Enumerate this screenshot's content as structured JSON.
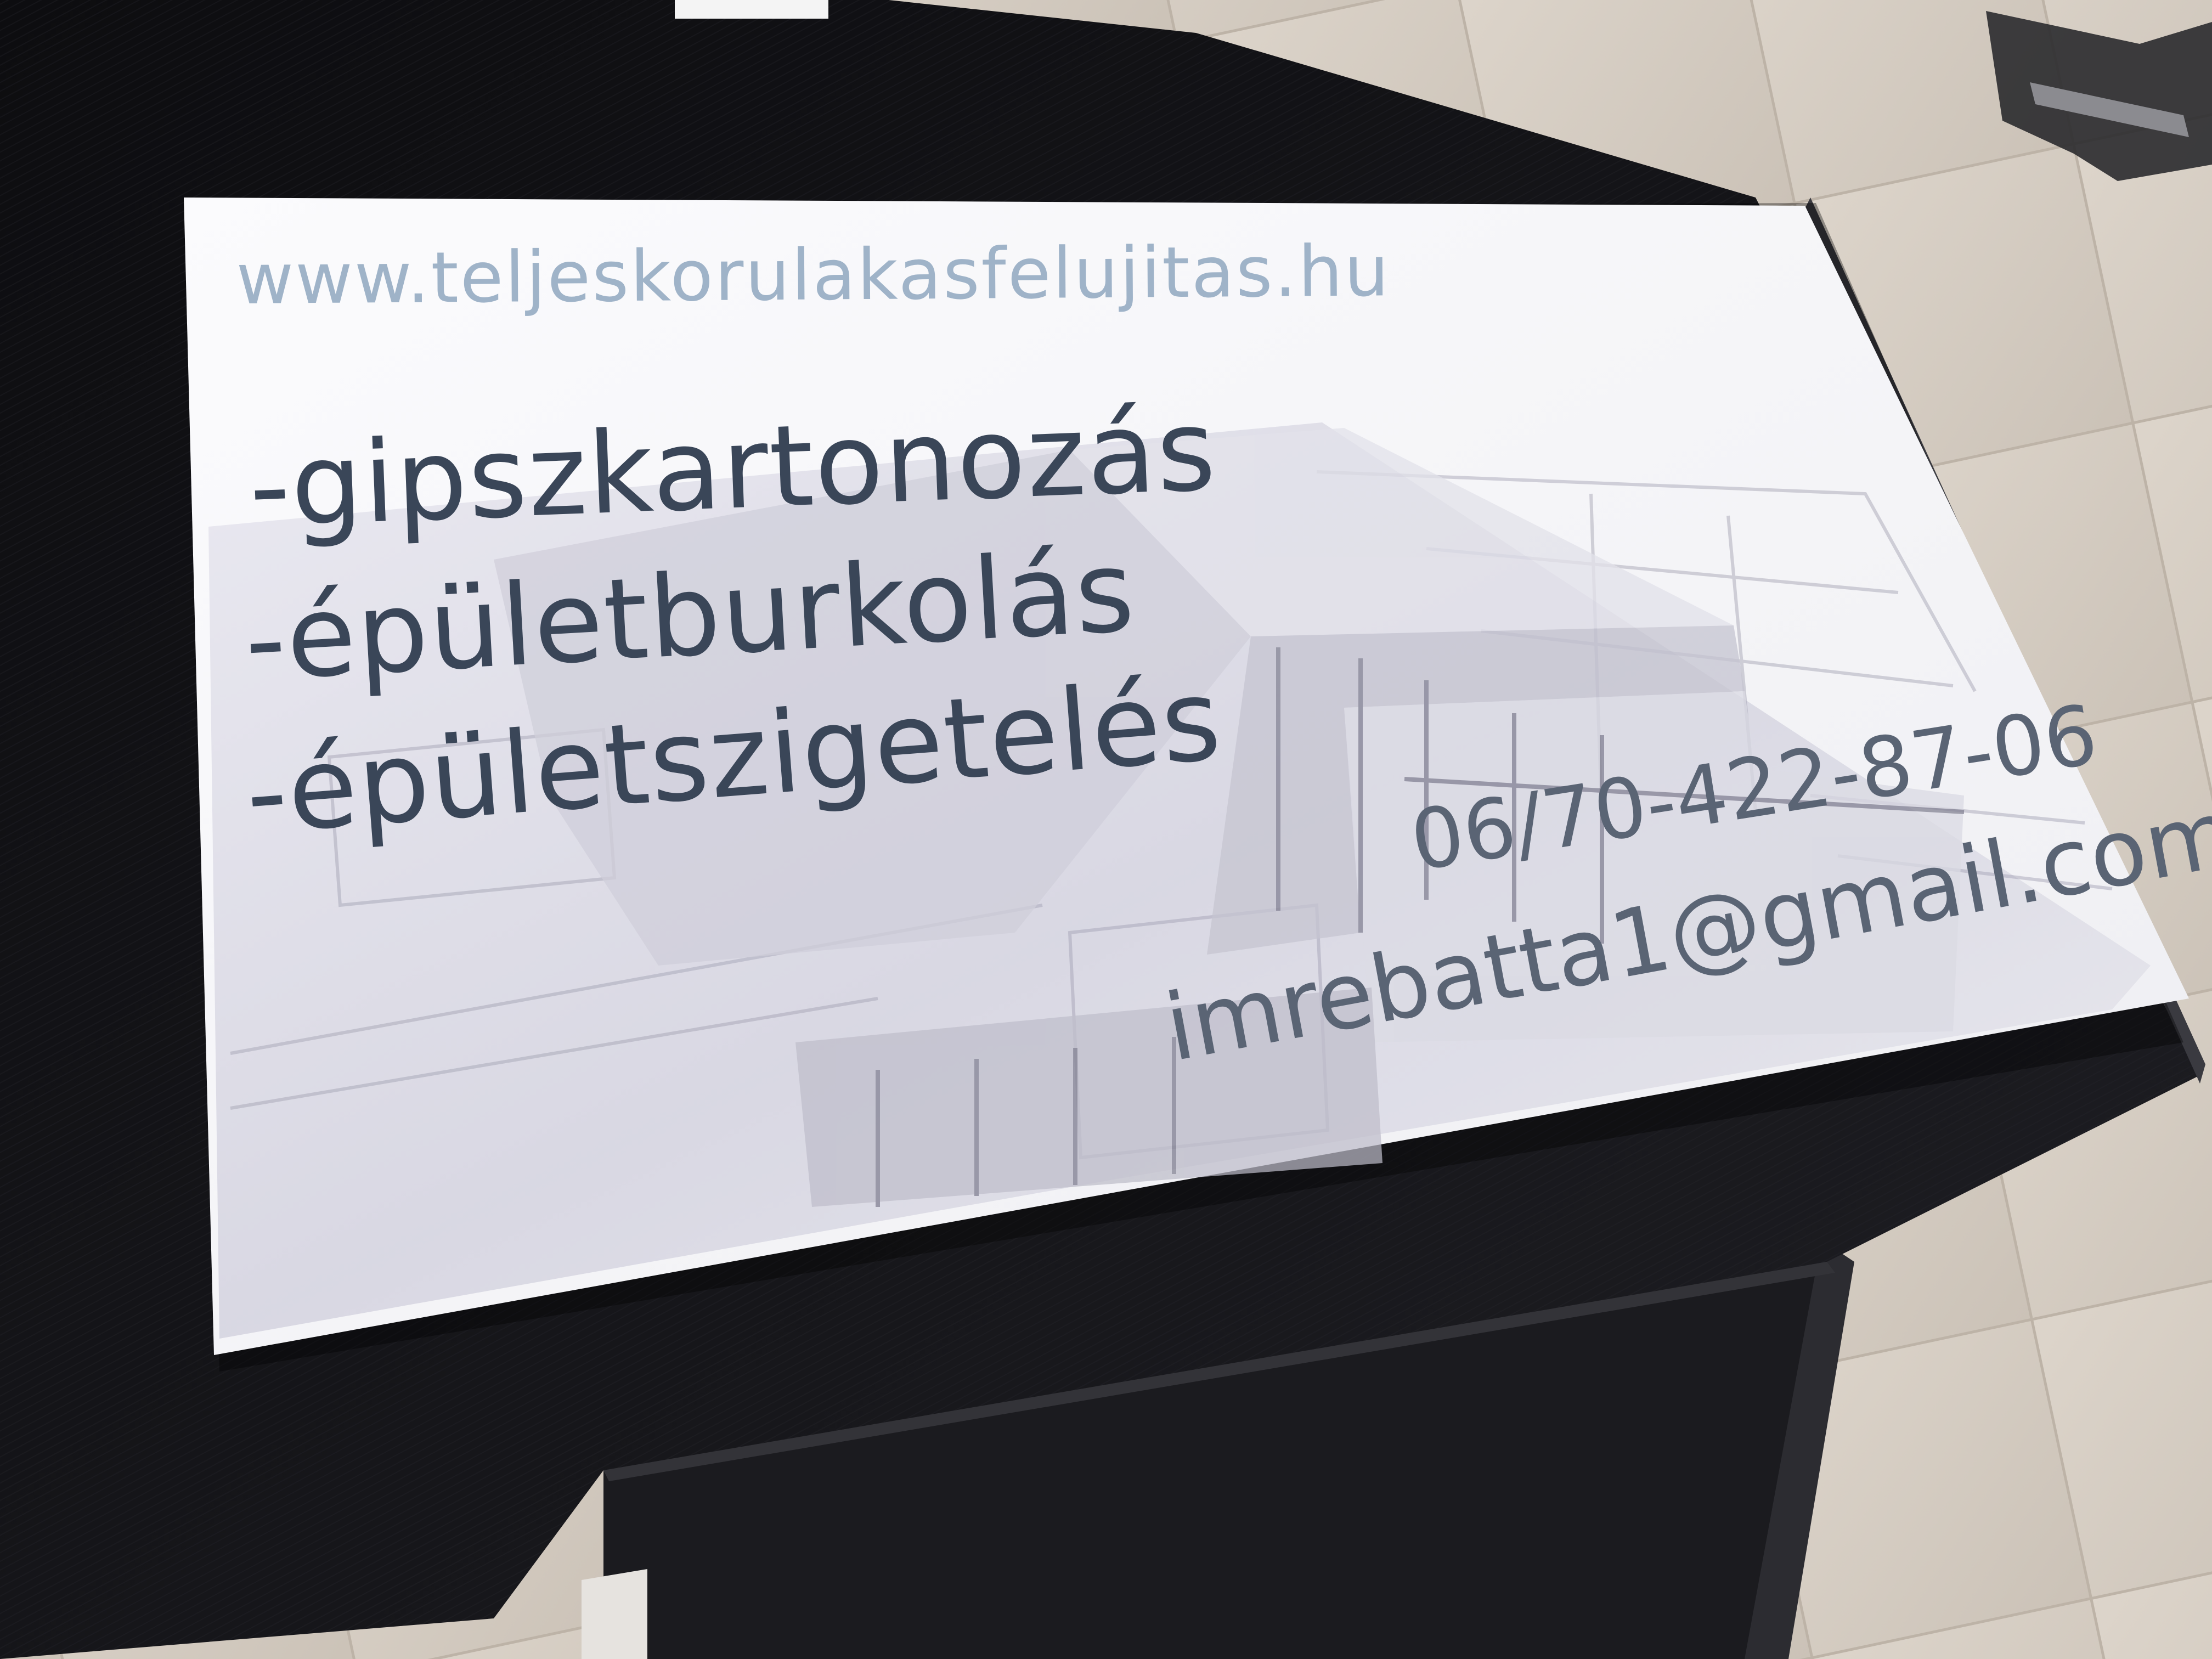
{
  "poster": {
    "website": "www.teljeskorulakasfelujitas.hu",
    "services": [
      "-gipszkartonozás",
      "-épületburkolás",
      "-épületszigetelés"
    ],
    "phone": "06/70-422-87-06",
    "email": "imrebatta1@gmail.com"
  },
  "colors": {
    "floor": "#d6cec4",
    "desk": "#111114",
    "paper": "#f7f7f9",
    "url_text": "#9fb3c8",
    "service_text": "#3a4658",
    "contact_text": "#5a6474"
  }
}
